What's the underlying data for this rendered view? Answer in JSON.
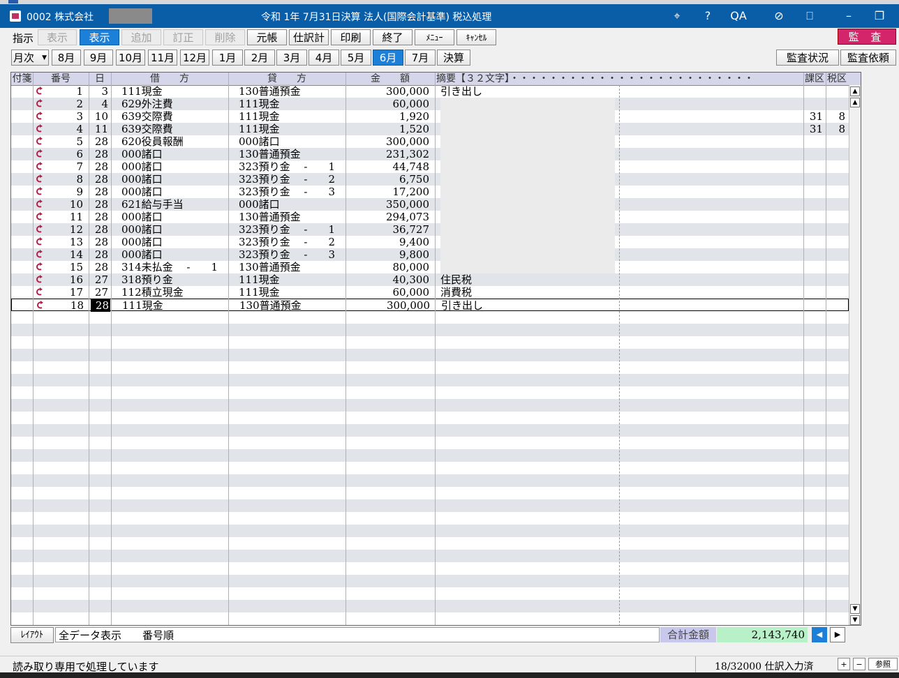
{
  "window": {
    "company": "0002 株式会社",
    "title": "令和 1年 7月31日決算 法人(国際会計基準) 税込処理"
  },
  "toolbar": {
    "shiji_label": "指示",
    "buttons": [
      "表示",
      "表示",
      "追加",
      "訂正",
      "削除",
      "元帳",
      "仕訳計",
      "印刷",
      "終了",
      "ﾒﾆｭｰ",
      "ｷｬﾝｾﾙ"
    ],
    "kansa": "監 査"
  },
  "period": {
    "selected": "月次",
    "months": [
      "8月",
      "9月",
      "10月",
      "11月",
      "12月",
      "1月",
      "2月",
      "3月",
      "4月",
      "5月",
      "6月",
      "7月",
      "決算"
    ],
    "active": "6月",
    "right_buttons": [
      "監査状況",
      "監査依頼"
    ]
  },
  "grid": {
    "headers": [
      "付箋",
      "番号",
      "日",
      "借　　方",
      "貸　　方",
      "金　　額",
      "摘要【３２文字】・・・・・・・・・・・・・・・・・・・・・・・・・",
      "課区",
      "税区"
    ],
    "rows": [
      {
        "no": "1",
        "day": "3",
        "debit": "111現金",
        "credit": "130普通預金",
        "amount": "300,000",
        "memo": "引き出し",
        "kaku": "",
        "zei": ""
      },
      {
        "no": "2",
        "day": "4",
        "debit": "629外注費",
        "credit": "111現金",
        "amount": "60,000",
        "memo": "",
        "kaku": "",
        "zei": ""
      },
      {
        "no": "3",
        "day": "10",
        "debit": "639交際費",
        "credit": "111現金",
        "amount": "1,920",
        "memo": "",
        "kaku": "31",
        "zei": "8"
      },
      {
        "no": "4",
        "day": "11",
        "debit": "639交際費",
        "credit": "111現金",
        "amount": "1,520",
        "memo": "",
        "kaku": "31",
        "zei": "8"
      },
      {
        "no": "5",
        "day": "28",
        "debit": "620役員報酬",
        "credit": "000諸口",
        "amount": "300,000",
        "memo": "",
        "kaku": "",
        "zei": ""
      },
      {
        "no": "6",
        "day": "28",
        "debit": "000諸口",
        "credit": "130普通預金",
        "amount": "231,302",
        "memo": "",
        "kaku": "",
        "zei": ""
      },
      {
        "no": "7",
        "day": "28",
        "debit": "000諸口",
        "credit": "323預り金　 -　　1",
        "amount": "44,748",
        "memo": "",
        "kaku": "",
        "zei": ""
      },
      {
        "no": "8",
        "day": "28",
        "debit": "000諸口",
        "credit": "323預り金　 -　　2",
        "amount": "6,750",
        "memo": "",
        "kaku": "",
        "zei": ""
      },
      {
        "no": "9",
        "day": "28",
        "debit": "000諸口",
        "credit": "323預り金　 -　　3",
        "amount": "17,200",
        "memo": "",
        "kaku": "",
        "zei": ""
      },
      {
        "no": "10",
        "day": "28",
        "debit": "621給与手当",
        "credit": "000諸口",
        "amount": "350,000",
        "memo": "",
        "kaku": "",
        "zei": ""
      },
      {
        "no": "11",
        "day": "28",
        "debit": "000諸口",
        "credit": "130普通預金",
        "amount": "294,073",
        "memo": "",
        "kaku": "",
        "zei": ""
      },
      {
        "no": "12",
        "day": "28",
        "debit": "000諸口",
        "credit": "323預り金　 -　　1",
        "amount": "36,727",
        "memo": "",
        "kaku": "",
        "zei": ""
      },
      {
        "no": "13",
        "day": "28",
        "debit": "000諸口",
        "credit": "323預り金　 -　　2",
        "amount": "9,400",
        "memo": "",
        "kaku": "",
        "zei": ""
      },
      {
        "no": "14",
        "day": "28",
        "debit": "000諸口",
        "credit": "323預り金　 -　　3",
        "amount": "9,800",
        "memo": "",
        "kaku": "",
        "zei": ""
      },
      {
        "no": "15",
        "day": "28",
        "debit": "314未払金　 -　　1",
        "credit": "130普通預金",
        "amount": "80,000",
        "memo": "",
        "kaku": "",
        "zei": ""
      },
      {
        "no": "16",
        "day": "27",
        "debit": "318預り金",
        "credit": "111現金",
        "amount": "40,300",
        "memo": "住民税",
        "kaku": "",
        "zei": ""
      },
      {
        "no": "17",
        "day": "27",
        "debit": "112積立現金",
        "credit": "111現金",
        "amount": "60,000",
        "memo": "消費税",
        "kaku": "",
        "zei": ""
      },
      {
        "no": "18",
        "day": "28",
        "debit": "111現金",
        "credit": "130普通預金",
        "amount": "300,000",
        "memo": "引き出し",
        "kaku": "",
        "zei": ""
      }
    ]
  },
  "footer": {
    "layout_btn": "ﾚｲｱｳﾄ",
    "mode": "全データ表示　　番号順",
    "total_label": "合計金額",
    "total_value": "2,143,740"
  },
  "status": {
    "message": "読み取り専用で処理しています",
    "count": "18/32000 仕訳入力済",
    "ref_label": "参照"
  }
}
